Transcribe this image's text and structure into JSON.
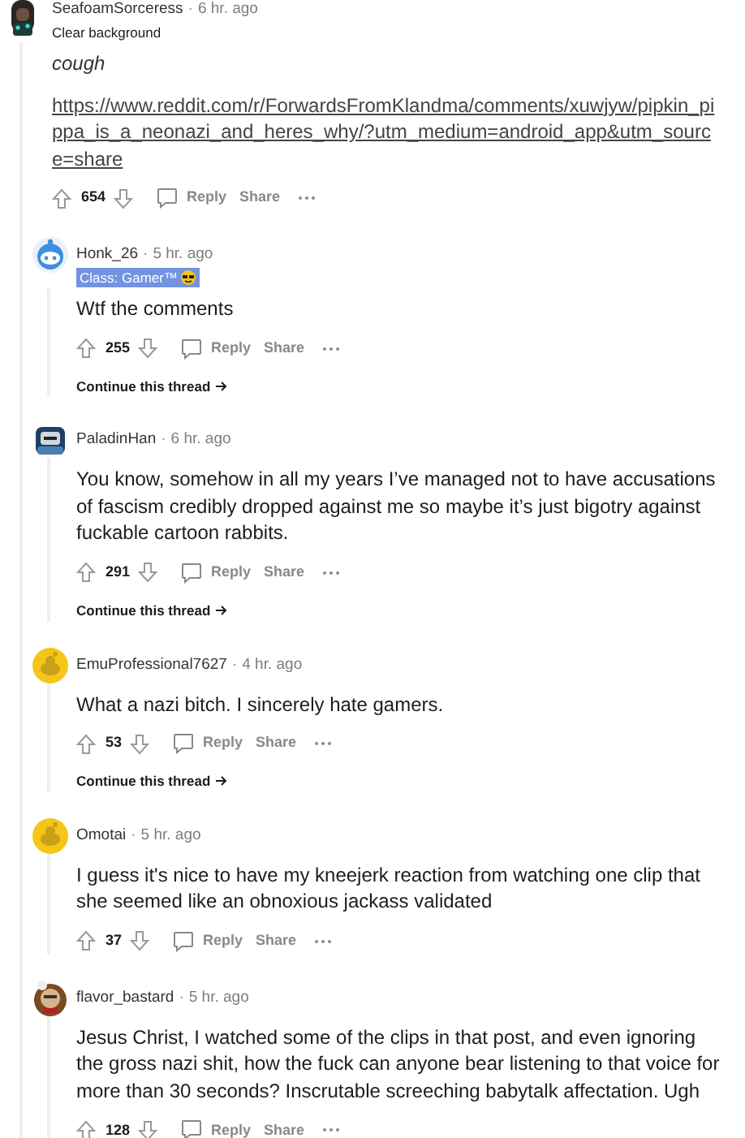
{
  "comment": {
    "username": "SeafoamSorceress",
    "separator": "·",
    "time": "6 hr. ago",
    "avatar": {
      "kind": "character_teal"
    },
    "flair_text": "Clear background",
    "paragraphs": [
      {
        "kind": "italic",
        "text": "cough"
      },
      {
        "kind": "link",
        "text": "https://www.reddit.com/r/ForwardsFromKlandma/comments/xuwjyw/pipkin_pippa_is_a_neonazi_and_heres_why/?utm_medium=android_app&utm_source=share"
      }
    ],
    "score": "654",
    "reply": "Reply",
    "share": "Share",
    "replies": [
      {
        "username": "Honk_26",
        "separator": "·",
        "time": "5 hr. ago",
        "avatar": {
          "kind": "snoo_blue"
        },
        "flair": {
          "text": "Class: Gamer™"
        },
        "paragraphs": [
          {
            "kind": "plain",
            "text": "Wtf the comments"
          }
        ],
        "score": "255",
        "reply": "Reply",
        "share": "Share",
        "continue_thread": "Continue this thread"
      },
      {
        "username": "PaladinHan",
        "separator": "·",
        "time": "6 hr. ago",
        "avatar": {
          "kind": "character_knight"
        },
        "paragraphs": [
          {
            "kind": "plain",
            "text": "You know, somehow in all my years I’ve managed not to have accusations of fascism credibly dropped against me so maybe it’s just bigotry against fuckable cartoon rabbits."
          }
        ],
        "score": "291",
        "reply": "Reply",
        "share": "Share",
        "continue_thread": "Continue this thread"
      },
      {
        "username": "EmuProfessional7627",
        "separator": "·",
        "time": "4 hr. ago",
        "avatar": {
          "kind": "snoo_yellow"
        },
        "paragraphs": [
          {
            "kind": "plain",
            "text": "What a nazi bitch. I sincerely hate gamers."
          }
        ],
        "score": "53",
        "reply": "Reply",
        "share": "Share",
        "continue_thread": "Continue this thread"
      },
      {
        "username": "Omotai",
        "separator": "·",
        "time": "5 hr. ago",
        "avatar": {
          "kind": "snoo_yellow"
        },
        "paragraphs": [
          {
            "kind": "plain",
            "text": "I guess it's nice to have my kneejerk reaction from watching one clip that she seemed like an obnoxious jackass validated"
          }
        ],
        "score": "37",
        "reply": "Reply",
        "share": "Share"
      },
      {
        "username": "flavor_bastard",
        "separator": "·",
        "time": "5 hr. ago",
        "avatar": {
          "kind": "character_chef"
        },
        "paragraphs": [
          {
            "kind": "plain",
            "text": "Jesus Christ, I watched some of the clips in that post, and even ignoring the gross nazi shit, how the fuck can anyone bear listening to that voice for more than 30 seconds? Inscrutable screeching babytalk affectation. Ugh"
          }
        ],
        "score": "128",
        "reply": "Reply",
        "share": "Share"
      }
    ]
  }
}
